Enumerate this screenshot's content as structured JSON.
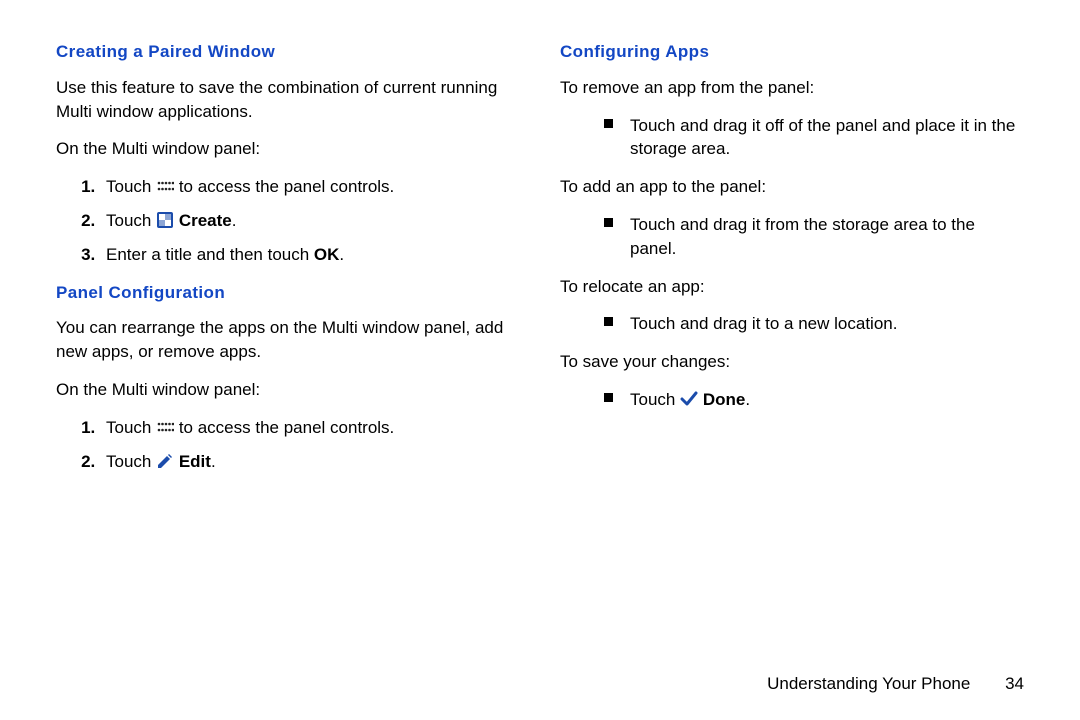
{
  "left": {
    "h1": "Creating a Paired Window",
    "p1": "Use this feature to save the combination of current running Multi window applications.",
    "p2": "On the Multi window panel:",
    "step1a": "Touch ",
    "step1b": " to access the panel controls.",
    "step2a": "Touch ",
    "step2b": "Create",
    "step2c": ".",
    "step3a": "Enter a title and then touch ",
    "step3b": "OK",
    "step3c": ".",
    "h2": "Panel Configuration",
    "p3": "You can rearrange the apps on the Multi window panel, add new apps, or remove apps.",
    "p4": "On the Multi window panel:",
    "step4a": "Touch ",
    "step4b": " to access the panel controls.",
    "step5a": "Touch ",
    "step5b": "Edit",
    "step5c": "."
  },
  "right": {
    "h1": "Configuring Apps",
    "p1": "To remove an app from the panel:",
    "b1": "Touch and drag it off of the panel and place it in the storage area.",
    "p2": "To add an app to the panel:",
    "b2": "Touch and drag it from the storage area to the panel.",
    "p3": "To relocate an app:",
    "b3": "Touch and drag it to a new location.",
    "p4": "To save your changes:",
    "b4a": "Touch ",
    "b4b": "Done",
    "b4c": "."
  },
  "footer": {
    "chapter": "Understanding Your Phone",
    "page": "34"
  }
}
